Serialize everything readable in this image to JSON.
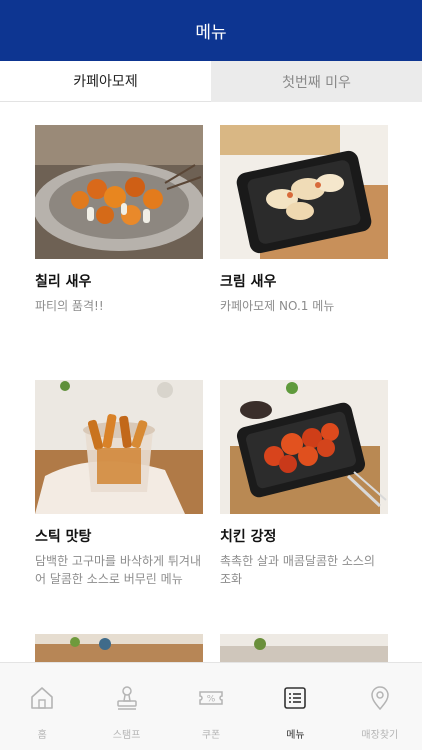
{
  "header": {
    "title": "메뉴"
  },
  "tabs": [
    {
      "label": "카페아모제",
      "active": true
    },
    {
      "label": "첫번째 미우",
      "active": false
    }
  ],
  "menu_items": [
    {
      "title": "칠리 새우",
      "description": "파티의 품격!!",
      "image": "chili-shrimp-plate"
    },
    {
      "title": "크림 새우",
      "description": "카페아모제 NO.1 메뉴",
      "image": "cream-shrimp-tray"
    },
    {
      "title": "스틱 맛탕",
      "description": "담백한 고구마를 바삭하게 튀겨내어 달콤한 소스로 버무린 메뉴",
      "image": "sweet-potato-cup"
    },
    {
      "title": "치킨 강정",
      "description": "촉촉한 살과 매콤달콤한 소스의 조화",
      "image": "chicken-gangjeong-tray"
    }
  ],
  "bottom_nav": [
    {
      "label": "홈",
      "icon": "home-icon",
      "active": false
    },
    {
      "label": "스탬프",
      "icon": "stamp-icon",
      "active": false
    },
    {
      "label": "쿠폰",
      "icon": "coupon-icon",
      "active": false
    },
    {
      "label": "메뉴",
      "icon": "menu-list-icon",
      "active": true
    },
    {
      "label": "매장찾기",
      "icon": "location-pin-icon",
      "active": false
    }
  ],
  "colors": {
    "header_bg": "#0d3591",
    "inactive_tab_bg": "#ebebeb",
    "nav_bg": "#f8f8f8"
  }
}
